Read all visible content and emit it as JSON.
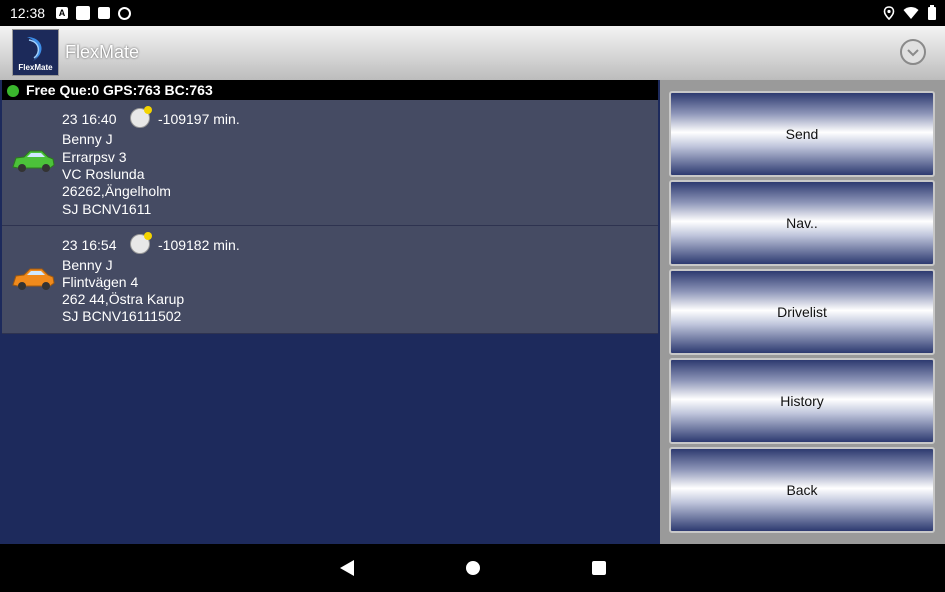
{
  "status_bar": {
    "time": "12:38",
    "left_icons": [
      "a-notification-icon",
      "square-notification-icon",
      "sd-card-icon",
      "at-sign-icon"
    ],
    "right_icons": [
      "location-icon",
      "wifi-icon",
      "battery-icon"
    ]
  },
  "app_bar": {
    "logo_text": "FlexMate",
    "title": "FlexMate",
    "menu_icon": "chevron-down-circle-icon"
  },
  "queue_status": {
    "text": "Free Que:0 GPS:763 BC:763",
    "indicator_color": "#3ab72d"
  },
  "orders": [
    {
      "time": "23 16:40",
      "minutes": "-109197 min.",
      "name": "Benny J",
      "street": "Errarpsv 3",
      "place": "VC Roslunda",
      "postal": "26262,Ängelholm",
      "ref": "SJ BCNV1611",
      "car_color": "#4cc23a",
      "car_icon": "green-car-icon"
    },
    {
      "time": "23 16:54",
      "minutes": "-109182 min.",
      "name": "Benny J",
      "street": "Flintvägen 4",
      "postal": "262 44,Östra Karup",
      "ref": "SJ BCNV16111502",
      "car_color": "#f08a1c",
      "car_icon": "orange-car-icon"
    }
  ],
  "actions": {
    "send": "Send",
    "nav": "Nav..",
    "drivelist": "Drivelist",
    "history": "History",
    "back": "Back"
  },
  "colors": {
    "list_background": "#1d2a5c",
    "order_background": "#454b63",
    "side_panel": "#9a9a9a"
  }
}
